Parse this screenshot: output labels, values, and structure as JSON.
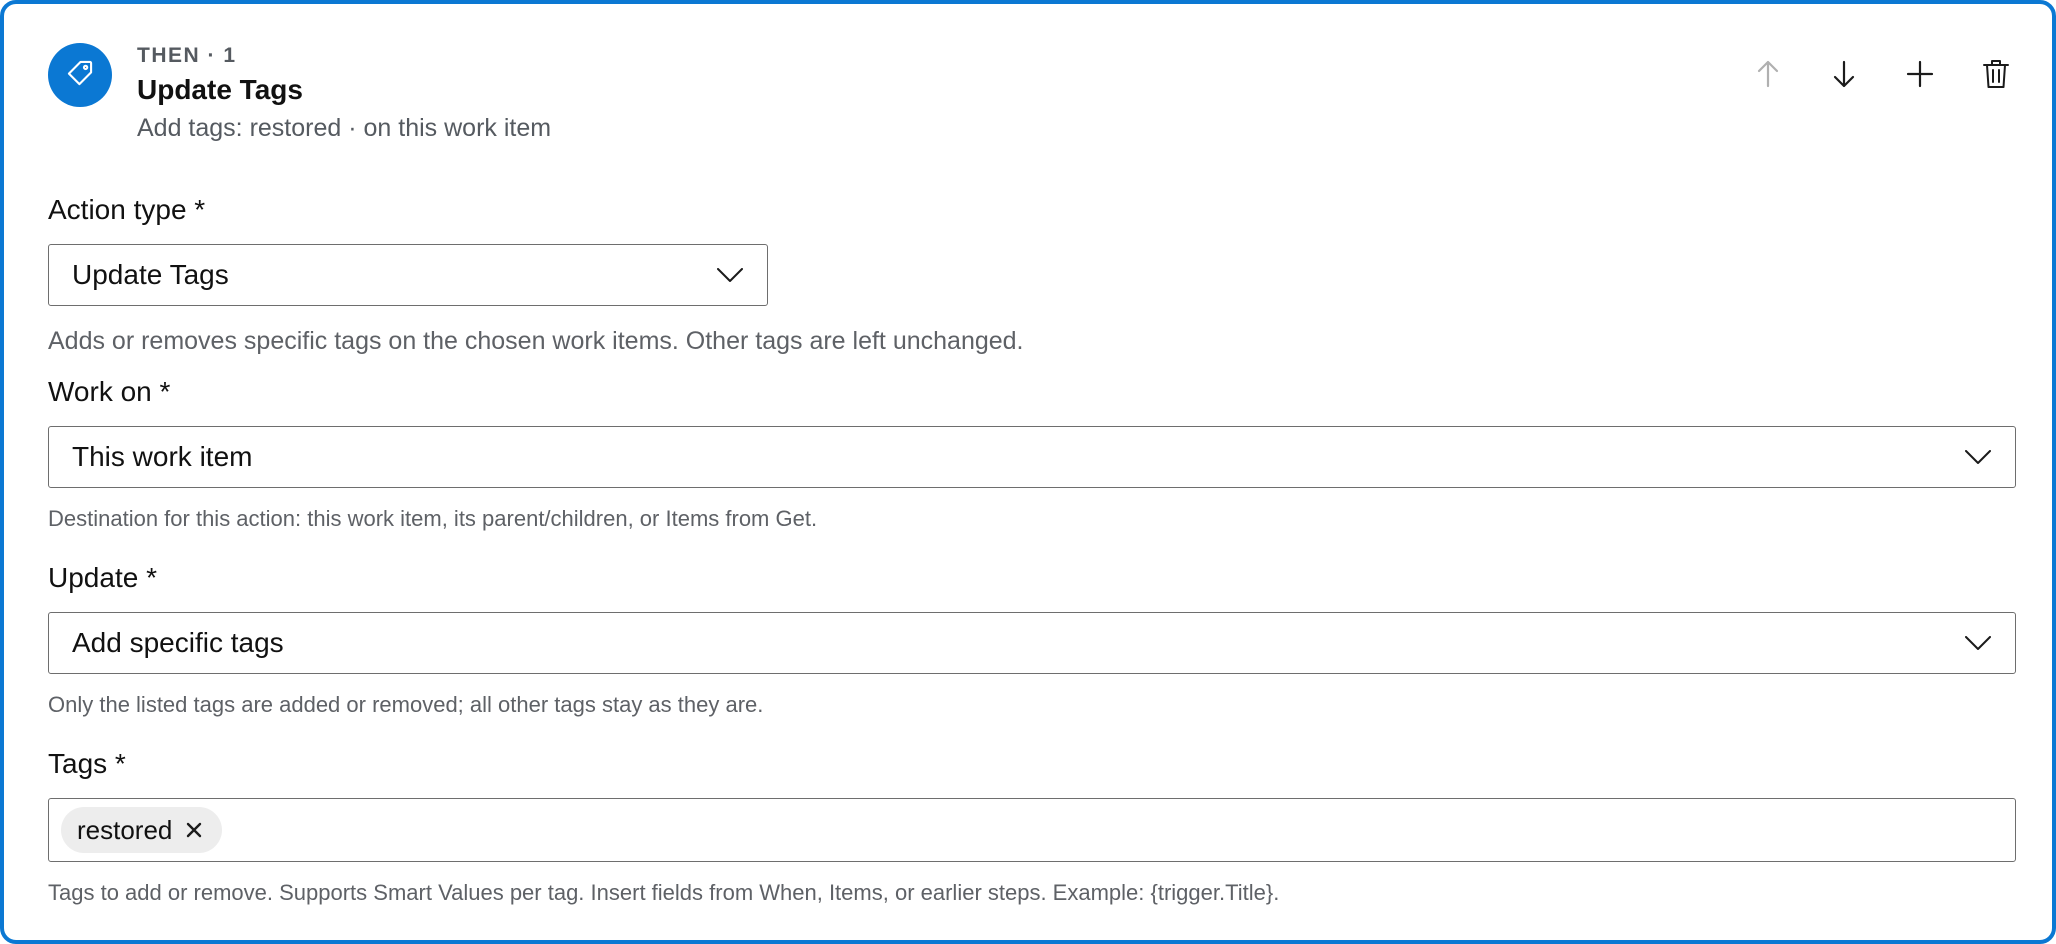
{
  "step": {
    "label": "THEN · 1",
    "title": "Update Tags",
    "summary": "Add tags: restored · on this work item",
    "icon": "tag-icon",
    "accent_color": "#0b78d3"
  },
  "toolbar": {
    "icons": [
      "arrow-up-icon",
      "arrow-down-icon",
      "plus-icon",
      "trash-icon"
    ],
    "move_up_enabled": false
  },
  "fields": {
    "action_type": {
      "label": "Action type *",
      "value": "Update Tags",
      "help": "Adds or removes specific tags on the chosen work items. Other tags are left unchanged."
    },
    "work_on": {
      "label": "Work on *",
      "value": "This work item",
      "help": "Destination for this action: this work item, its parent/children, or Items from Get."
    },
    "update": {
      "label": "Update *",
      "value": "Add specific tags",
      "help": "Only the listed tags are added or removed; all other tags stay as they are."
    },
    "tags": {
      "label": "Tags *",
      "chips": [
        "restored"
      ],
      "help": "Tags to add or remove. Supports Smart Values per tag. Insert fields from When, Items, or earlier steps. Example: {trigger.Title}."
    }
  }
}
